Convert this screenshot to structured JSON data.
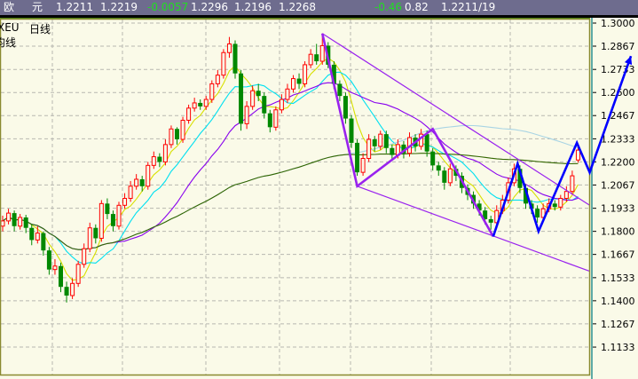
{
  "header": {
    "name_1": "欧",
    "name_2": "元",
    "fields": [
      "1.2211",
      "1.2219",
      "-0.0057",
      "1.2296",
      "1.2196",
      "1.2268",
      "-0.46",
      "0.82",
      "1.2211/19"
    ],
    "negative_color": "#22dd22"
  },
  "labels": {
    "symbol": "XEU",
    "period": "日线",
    "indicator": "均线"
  },
  "chart_data": {
    "type": "candlestick",
    "title": "",
    "ylim": [
      1.105,
      1.3025
    ],
    "y_ticks": [
      "1.3000",
      "1.2867",
      "1.2733",
      "1.2600",
      "1.2467",
      "1.2333",
      "1.2200",
      "1.2067",
      "1.1933",
      "1.1800",
      "1.1667",
      "1.1533",
      "1.1400",
      "1.1267",
      "1.1133"
    ],
    "grid": true,
    "colors": {
      "up": "#ff0000",
      "down": "#008800",
      "ma5": "#d8e000",
      "ma10": "#00e0f0",
      "ma20": "#8800ee",
      "ma60": "#a8d4e4",
      "ma120": "#336600",
      "trend": "#9922ee",
      "wave": "#0000ff"
    },
    "candles_ohlc": [
      [
        1.183,
        1.189,
        1.18,
        1.186
      ],
      [
        1.186,
        1.193,
        1.184,
        1.1905
      ],
      [
        1.1905,
        1.192,
        1.18,
        1.183
      ],
      [
        1.183,
        1.19,
        1.181,
        1.188
      ],
      [
        1.188,
        1.1895,
        1.179,
        1.182
      ],
      [
        1.182,
        1.184,
        1.172,
        1.175
      ],
      [
        1.175,
        1.183,
        1.173,
        1.179
      ],
      [
        1.179,
        1.18,
        1.166,
        1.169
      ],
      [
        1.169,
        1.171,
        1.155,
        1.158
      ],
      [
        1.158,
        1.164,
        1.155,
        1.16
      ],
      [
        1.16,
        1.162,
        1.145,
        1.148
      ],
      [
        1.148,
        1.151,
        1.139,
        1.143
      ],
      [
        1.143,
        1.153,
        1.141,
        1.15
      ],
      [
        1.15,
        1.163,
        1.148,
        1.161
      ],
      [
        1.161,
        1.173,
        1.159,
        1.17
      ],
      [
        1.17,
        1.185,
        1.168,
        1.182
      ],
      [
        1.182,
        1.184,
        1.173,
        1.176
      ],
      [
        1.176,
        1.198,
        1.174,
        1.196
      ],
      [
        1.196,
        1.199,
        1.187,
        1.19
      ],
      [
        1.19,
        1.192,
        1.18,
        1.183
      ],
      [
        1.183,
        1.197,
        1.181,
        1.195
      ],
      [
        1.195,
        1.202,
        1.193,
        1.199
      ],
      [
        1.199,
        1.209,
        1.197,
        1.206
      ],
      [
        1.206,
        1.213,
        1.204,
        1.21
      ],
      [
        1.21,
        1.212,
        1.203,
        1.206
      ],
      [
        1.206,
        1.22,
        1.204,
        1.218
      ],
      [
        1.218,
        1.226,
        1.216,
        1.223
      ],
      [
        1.223,
        1.225,
        1.217,
        1.22
      ],
      [
        1.22,
        1.233,
        1.218,
        1.23
      ],
      [
        1.23,
        1.241,
        1.228,
        1.239
      ],
      [
        1.239,
        1.24,
        1.23,
        1.233
      ],
      [
        1.233,
        1.246,
        1.231,
        1.244
      ],
      [
        1.244,
        1.253,
        1.242,
        1.251
      ],
      [
        1.251,
        1.257,
        1.249,
        1.254
      ],
      [
        1.254,
        1.256,
        1.25,
        1.252
      ],
      [
        1.252,
        1.258,
        1.25,
        1.256
      ],
      [
        1.256,
        1.267,
        1.254,
        1.265
      ],
      [
        1.265,
        1.273,
        1.263,
        1.27
      ],
      [
        1.27,
        1.285,
        1.268,
        1.283
      ],
      [
        1.283,
        1.292,
        1.28,
        1.288
      ],
      [
        1.288,
        1.29,
        1.268,
        1.271
      ],
      [
        1.271,
        1.273,
        1.238,
        1.242
      ],
      [
        1.242,
        1.255,
        1.239,
        1.252
      ],
      [
        1.252,
        1.264,
        1.25,
        1.261
      ],
      [
        1.261,
        1.265,
        1.255,
        1.258
      ],
      [
        1.258,
        1.26,
        1.245,
        1.248
      ],
      [
        1.248,
        1.25,
        1.237,
        1.24
      ],
      [
        1.24,
        1.252,
        1.238,
        1.25
      ],
      [
        1.25,
        1.259,
        1.248,
        1.256
      ],
      [
        1.256,
        1.265,
        1.254,
        1.262
      ],
      [
        1.262,
        1.27,
        1.26,
        1.268
      ],
      [
        1.268,
        1.271,
        1.262,
        1.265
      ],
      [
        1.265,
        1.278,
        1.263,
        1.276
      ],
      [
        1.276,
        1.285,
        1.274,
        1.282
      ],
      [
        1.282,
        1.288,
        1.276,
        1.278
      ],
      [
        1.278,
        1.294,
        1.276,
        1.287
      ],
      [
        1.287,
        1.289,
        1.274,
        1.276
      ],
      [
        1.276,
        1.278,
        1.262,
        1.265
      ],
      [
        1.265,
        1.267,
        1.255,
        1.258
      ],
      [
        1.258,
        1.26,
        1.242,
        1.245
      ],
      [
        1.245,
        1.247,
        1.228,
        1.231
      ],
      [
        1.231,
        1.233,
        1.212,
        1.214
      ],
      [
        1.214,
        1.225,
        1.212,
        1.222
      ],
      [
        1.222,
        1.236,
        1.22,
        1.233
      ],
      [
        1.233,
        1.235,
        1.226,
        1.229
      ],
      [
        1.229,
        1.238,
        1.227,
        1.236
      ],
      [
        1.236,
        1.238,
        1.225,
        1.228
      ],
      [
        1.228,
        1.23,
        1.221,
        1.224
      ],
      [
        1.224,
        1.233,
        1.222,
        1.23
      ],
      [
        1.23,
        1.232,
        1.222,
        1.225
      ],
      [
        1.225,
        1.237,
        1.223,
        1.234
      ],
      [
        1.234,
        1.236,
        1.226,
        1.229
      ],
      [
        1.229,
        1.239,
        1.227,
        1.236
      ],
      [
        1.236,
        1.238,
        1.223,
        1.226
      ],
      [
        1.226,
        1.228,
        1.215,
        1.218
      ],
      [
        1.218,
        1.22,
        1.212,
        1.215
      ],
      [
        1.215,
        1.217,
        1.204,
        1.208
      ],
      [
        1.208,
        1.219,
        1.206,
        1.216
      ],
      [
        1.216,
        1.218,
        1.209,
        1.212
      ],
      [
        1.212,
        1.214,
        1.202,
        1.205
      ],
      [
        1.205,
        1.207,
        1.198,
        1.201
      ],
      [
        1.201,
        1.203,
        1.193,
        1.196
      ],
      [
        1.196,
        1.198,
        1.189,
        1.192
      ],
      [
        1.192,
        1.194,
        1.184,
        1.187
      ],
      [
        1.187,
        1.189,
        1.181,
        1.185
      ],
      [
        1.185,
        1.195,
        1.183,
        1.192
      ],
      [
        1.192,
        1.201,
        1.19,
        1.198
      ],
      [
        1.198,
        1.211,
        1.196,
        1.208
      ],
      [
        1.208,
        1.219,
        1.206,
        1.216
      ],
      [
        1.216,
        1.218,
        1.202,
        1.205
      ],
      [
        1.205,
        1.207,
        1.193,
        1.196
      ],
      [
        1.196,
        1.198,
        1.19,
        1.193
      ],
      [
        1.193,
        1.195,
        1.185,
        1.188
      ],
      [
        1.188,
        1.196,
        1.187,
        1.193
      ],
      [
        1.193,
        1.199,
        1.191,
        1.196
      ],
      [
        1.196,
        1.198,
        1.192,
        1.194
      ],
      [
        1.194,
        1.201,
        1.192,
        1.199
      ],
      [
        1.199,
        1.206,
        1.197,
        1.203
      ],
      [
        1.203,
        1.215,
        1.201,
        1.212
      ],
      [
        1.2211,
        1.2296,
        1.2196,
        1.2268
      ]
    ],
    "moving_averages": [
      5,
      10,
      20,
      60,
      120
    ],
    "trend_lines": [
      {
        "from": [
          55,
          1.294
        ],
        "to": [
          101,
          1.195
        ]
      },
      {
        "from": [
          61,
          1.206
        ],
        "to": [
          101,
          1.157
        ]
      }
    ],
    "zigzag_purple": [
      [
        55,
        1.294
      ],
      [
        61,
        1.206
      ],
      [
        74,
        1.239
      ],
      [
        84.4,
        1.177
      ]
    ],
    "zigzag_blue": [
      [
        84.4,
        1.177
      ],
      [
        88.6,
        1.219
      ],
      [
        92.2,
        1.18
      ],
      [
        98.8,
        1.231
      ],
      [
        101,
        1.214
      ],
      [
        108.1,
        1.281
      ]
    ]
  }
}
